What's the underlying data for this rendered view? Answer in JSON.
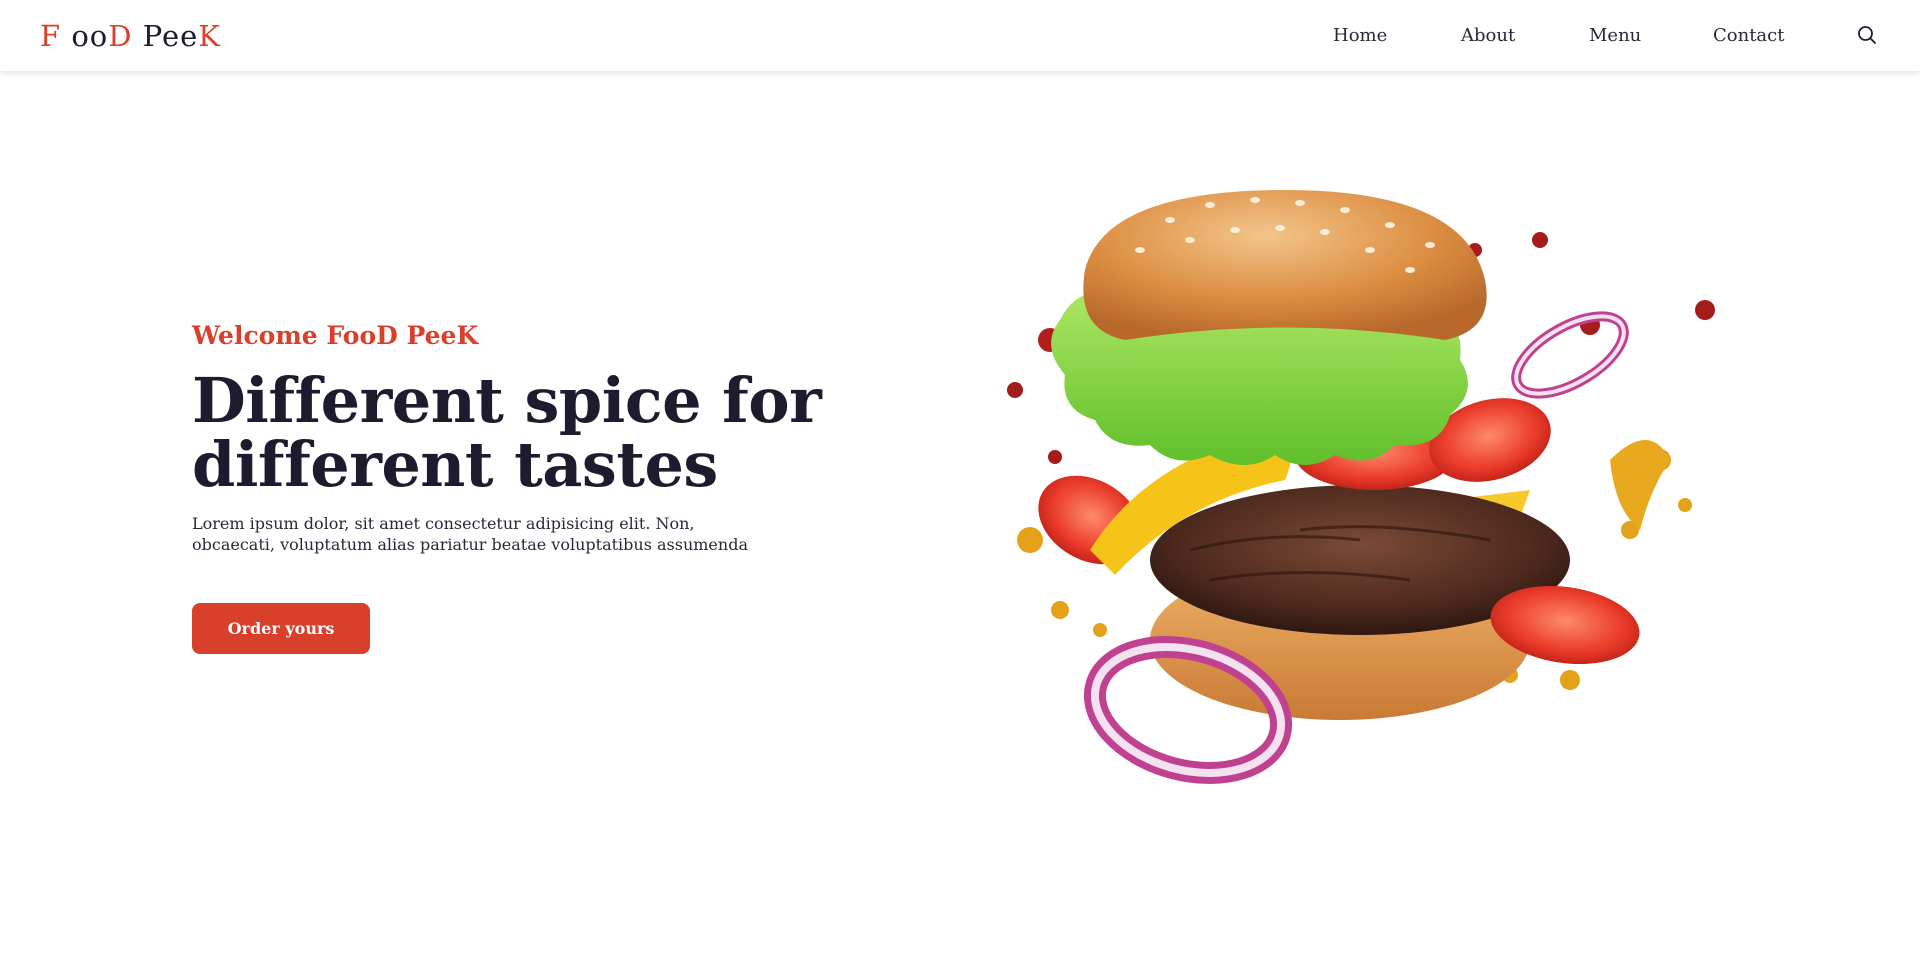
{
  "brand": {
    "parts": [
      "F ",
      "oo",
      "D ",
      "Pee",
      "K"
    ],
    "accent_color": "#d8402c",
    "dark_color": "#1e1b2e"
  },
  "nav": {
    "items": [
      {
        "label": "Home"
      },
      {
        "label": "About"
      },
      {
        "label": "Menu"
      },
      {
        "label": "Contact"
      }
    ],
    "search_icon": "search-icon"
  },
  "hero": {
    "eyebrow": "Welcome FooD PeeK",
    "headline_line1": "Different spice for",
    "headline_line2": "different tastes",
    "description": "Lorem ipsum dolor, sit amet consectetur adipisicing elit. Non, obcaecati, voluptatum alias pariatur beatae voluptatibus assumenda",
    "cta_label": "Order yours",
    "image_subject": "exploding burger with lettuce, tomato, onion rings, cheese and sauce splashes"
  }
}
